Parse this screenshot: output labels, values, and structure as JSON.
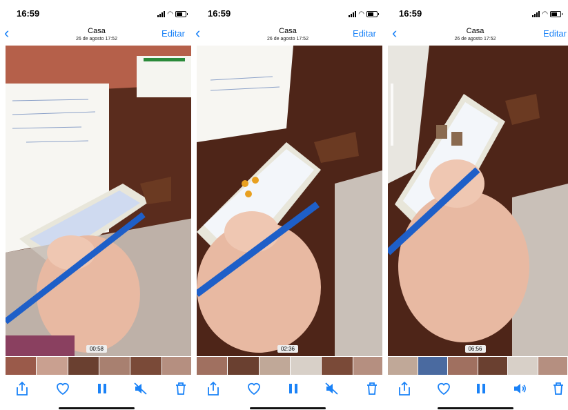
{
  "panels": [
    {
      "time": "16:59",
      "title": "Casa",
      "subtitle": "26 de agosto 17:52",
      "edit_label": "Editar",
      "timestamp": "00:58",
      "audio": "muted"
    },
    {
      "time": "16:59",
      "title": "Casa",
      "subtitle": "26 de agosto 17:52",
      "edit_label": "Editar",
      "timestamp": "02:36",
      "audio": "muted"
    },
    {
      "time": "16:59",
      "title": "Casa",
      "subtitle": "26 de agosto 17:52",
      "edit_label": "Editar",
      "timestamp": "06:56",
      "audio": "on"
    }
  ],
  "icons": {
    "back": "chevron-left-icon",
    "share": "share-icon",
    "favorite": "heart-icon",
    "pause": "pause-icon",
    "mute": "speaker-muted-icon",
    "sound": "speaker-on-icon",
    "delete": "trash-icon"
  },
  "colors": {
    "accent": "#1a82f7",
    "table": "#4a2316",
    "floor": "#c9c0b8"
  }
}
